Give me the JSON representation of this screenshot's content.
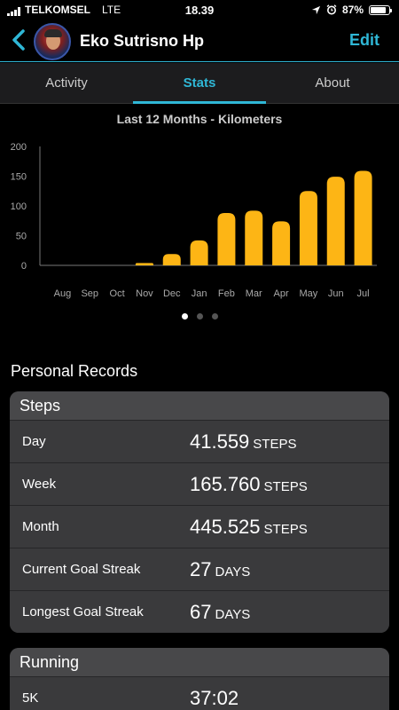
{
  "status_bar": {
    "carrier": "TELKOMSEL",
    "network": "LTE",
    "time": "18.39",
    "battery": "87%",
    "battery_level": 0.87
  },
  "header": {
    "name": "Eko Sutrisno Hp",
    "edit_label": "Edit"
  },
  "tabs": [
    {
      "label": "Activity",
      "active": false
    },
    {
      "label": "Stats",
      "active": true
    },
    {
      "label": "About",
      "active": false
    }
  ],
  "chart_data": {
    "type": "bar",
    "title": "Last 12 Months - Kilometers",
    "categories": [
      "Aug",
      "Sep",
      "Oct",
      "Nov",
      "Dec",
      "Jan",
      "Feb",
      "Mar",
      "Apr",
      "May",
      "Jun",
      "Jul"
    ],
    "values": [
      0,
      0,
      0,
      4,
      19,
      42,
      88,
      92,
      74,
      125,
      149,
      159
    ],
    "yticks": [
      0,
      50,
      100,
      150,
      200
    ],
    "ylim": [
      0,
      200
    ],
    "bar_color": "#fdb515",
    "grid": false
  },
  "pagination": {
    "count": 3,
    "active": 0
  },
  "personal_records": {
    "title": "Personal Records",
    "steps": {
      "header": "Steps",
      "rows": [
        {
          "label": "Day",
          "value": "41.559",
          "unit": "STEPS"
        },
        {
          "label": "Week",
          "value": "165.760",
          "unit": "STEPS"
        },
        {
          "label": "Month",
          "value": "445.525",
          "unit": "STEPS"
        },
        {
          "label": "Current Goal Streak",
          "value": "27",
          "unit": "DAYS"
        },
        {
          "label": "Longest Goal Streak",
          "value": "67",
          "unit": "DAYS"
        }
      ]
    },
    "running": {
      "header": "Running",
      "rows": [
        {
          "label": "5K",
          "value": "37:02",
          "unit": ""
        }
      ]
    }
  },
  "colors": {
    "accent": "#2fb7d6",
    "bar": "#fdb515",
    "card": "#3a3a3c"
  }
}
